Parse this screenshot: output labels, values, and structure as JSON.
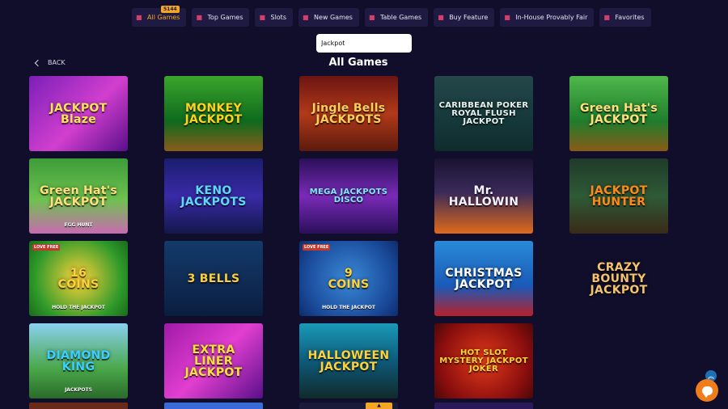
{
  "tabs": [
    {
      "label": "All Games",
      "icon": "cards-icon",
      "active": true,
      "badge": "5144"
    },
    {
      "label": "Top Games",
      "icon": "trophy-icon"
    },
    {
      "label": "Slots",
      "icon": "slot-machine-icon"
    },
    {
      "label": "New Games",
      "icon": "cocktail-icon"
    },
    {
      "label": "Table Games",
      "icon": "dice-icon"
    },
    {
      "label": "Buy Feature",
      "icon": "cart-icon"
    },
    {
      "label": "In-House Provably Fair",
      "icon": "shield-icon"
    },
    {
      "label": "Favorites",
      "icon": "heart-icon"
    }
  ],
  "search": {
    "value": "Jackpot"
  },
  "back_label": "BACK",
  "page_title": "All Games",
  "games": [
    {
      "title": "JACKPOT\nBlaze",
      "sub": "",
      "ribbon": "",
      "bg": "linear-gradient(135deg,#7a1fb8,#d23fcf 55%,#5a0f8a)",
      "color": "#ffe25a"
    },
    {
      "title": "MONKEY\nJACKPOT",
      "sub": "",
      "ribbon": "",
      "bg": "linear-gradient(180deg,#3aa52a,#0f6a1e 60%,#8a5b1a)",
      "color": "#ffd21c"
    },
    {
      "title": "Jingle Bells\nJACKPOTS",
      "sub": "",
      "ribbon": "",
      "bg": "linear-gradient(180deg,#6b1412,#b23a1a 50%,#5c1a0c)",
      "color": "#ffcf5a"
    },
    {
      "title": "CARIBBEAN POKER\nROYAL FLUSH JACKPOT",
      "sub": "",
      "ribbon": "",
      "bg": "linear-gradient(180deg,#24484a,#15383a 60%,#0f2c2c)",
      "color": "#e8f0ee"
    },
    {
      "title": "Green Hat's\nJACKPOT",
      "sub": "",
      "ribbon": "",
      "bg": "linear-gradient(180deg,#4fb84a,#1f7d2d 60%,#8a5a16)",
      "color": "#ffe07a"
    },
    {
      "title": "Green Hat's\nJACKPOT",
      "sub": "EGG HUNT",
      "ribbon": "",
      "bg": "linear-gradient(180deg,#3e9c3a,#6ec24f 55%,#c86ab0)",
      "color": "#ffe07a"
    },
    {
      "title": "KENO\nJACKPOTS",
      "sub": "",
      "ribbon": "",
      "bg": "linear-gradient(180deg,#1a1d6e,#3a2aa8 50%,#12184a)",
      "color": "#5fd7ff"
    },
    {
      "title": "MEGA JACKPOTS\nDISCO",
      "sub": "",
      "ribbon": "",
      "bg": "linear-gradient(180deg,#2a1058,#7a2ab8 50%,#2a0f5a)",
      "color": "#7fe8ff"
    },
    {
      "title": "Mr. HALLOWIN",
      "sub": "",
      "ribbon": "",
      "bg": "linear-gradient(180deg,#1a1230,#3a2a5a 45%,#e06a1a)",
      "color": "#f3f0ff"
    },
    {
      "title": "JACKPOT\nHUNTER",
      "sub": "",
      "ribbon": "",
      "bg": "linear-gradient(180deg,#1f3a2a,#2e5a36 50%,#3a2a18)",
      "color": "#ff8a1c"
    },
    {
      "title": "16\nCOINS",
      "sub": "HOLD THE JACKPOT",
      "ribbon": "LOVE FREE",
      "bg": "radial-gradient(circle,#ffd23a,#2e9a2a 70%,#1a6a1a)",
      "color": "#ffd23a"
    },
    {
      "title": "3 BELLS",
      "sub": "",
      "ribbon": "",
      "bg": "linear-gradient(180deg,#143a6a,#0e2a52 60%,#0a1e3e)",
      "color": "#ffcf3a"
    },
    {
      "title": "9\nCOINS",
      "sub": "HOLD THE JACKPOT",
      "ribbon": "LOVE FREE",
      "bg": "radial-gradient(circle,#3a8ad8,#1a4a9a 70%,#0e2c6a)",
      "color": "#ffd23a"
    },
    {
      "title": "CHRISTMAS\nJACKPOT",
      "sub": "",
      "ribbon": "",
      "bg": "linear-gradient(180deg,#2a8ad8,#1a5ab8 60%,#b8202a)",
      "color": "#ffffff"
    },
    {
      "title": "CRAZY\nBOUNTY\nJACKPOT",
      "sub": "",
      "ribbon": "",
      "bg": "#110e2c",
      "color": "#f5c36a"
    },
    {
      "title": "DIAMOND\nKING",
      "sub": "JACKPOTS",
      "ribbon": "",
      "bg": "linear-gradient(180deg,#8ad0f0,#4aa84a 60%,#2a6a2a)",
      "color": "#3ad0ff"
    },
    {
      "title": "EXTRA\nLINER\nJACKPOT",
      "sub": "",
      "ribbon": "",
      "bg": "linear-gradient(135deg,#a01aa8,#e23fd0 50%,#5a0f8a)",
      "color": "#ffe13a"
    },
    {
      "title": "HALLOWEEN\nJACKPOT",
      "sub": "",
      "ribbon": "",
      "bg": "linear-gradient(180deg,#1a9ab8,#0e5a7a 50%,#102a2a)",
      "color": "#ffd23a"
    },
    {
      "title": "HOT SLOT\nMYSTERY JACKPOT\nJOKER",
      "sub": "",
      "ribbon": "",
      "bg": "radial-gradient(circle,#e23a1a,#8a0e0e 70%,#4a0808)",
      "color": "#ffd23a"
    }
  ],
  "next_row_colors": [
    "#6a2a1a",
    "#3a6ad8",
    "#1a1a3a",
    "#2a1a5a",
    "#110e2c"
  ],
  "scroll_up_label": "︽"
}
